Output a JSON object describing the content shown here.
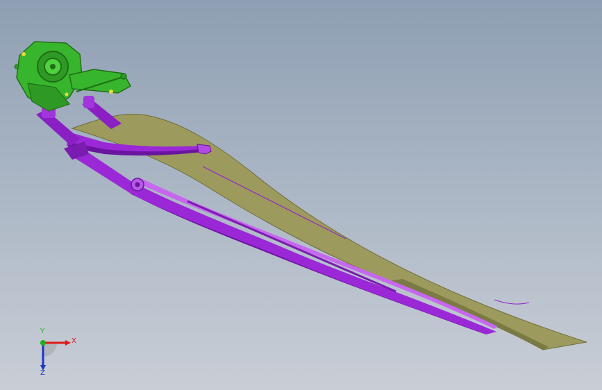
{
  "viewport": {
    "model": "wiper-assembly-model",
    "colors": {
      "blade": "#9c9a5d",
      "blade_edge": "#6f6d3a",
      "arm": "#9b28d6",
      "arm_dark": "#6a14a0",
      "arm_light": "#c767f0",
      "motor": "#37b52c",
      "motor_dark": "#1f6f16",
      "accent": "#e8d840"
    }
  },
  "triad": {
    "x_label": "X",
    "y_label": "Y",
    "z_label": "Z",
    "colors": {
      "x": "#e01818",
      "y": "#19b219",
      "z": "#1e35c8"
    }
  }
}
